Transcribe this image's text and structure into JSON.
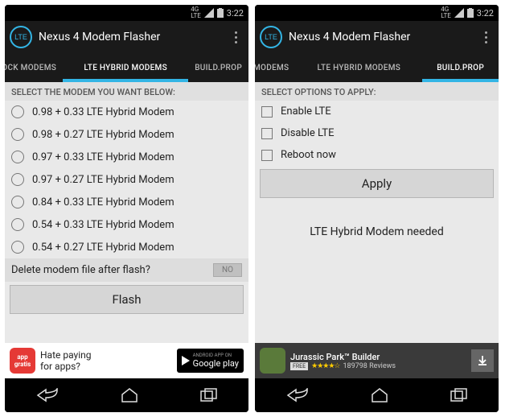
{
  "status": {
    "net": "4G\nLTE",
    "time": "3:22"
  },
  "app": {
    "title": "Nexus 4 Modem Flasher",
    "icon_label": "LTE"
  },
  "left": {
    "tabs": {
      "t0": "TOCK MODEMS",
      "t1": "LTE HYBRID MODEMS",
      "t2": "BUILD.PROP"
    },
    "section": "SELECT THE MODEM YOU WANT BELOW:",
    "modems": {
      "m0": "0.98 + 0.33 LTE Hybrid Modem",
      "m1": "0.98 + 0.27 LTE Hybrid Modem",
      "m2": "0.97 + 0.33 LTE Hybrid Modem",
      "m3": "0.97 + 0.27 LTE Hybrid Modem",
      "m4": "0.84 + 0.33 LTE Hybrid Modem",
      "m5": "0.54 + 0.33 LTE Hybrid Modem",
      "m6": "0.54 + 0.27 LTE Hybrid Modem"
    },
    "delete_q": "Delete modem file after flash?",
    "toggle": "NO",
    "flash": "Flash",
    "ad": {
      "icon": "app\ngratis",
      "line1": "Hate paying",
      "line2": "for apps?",
      "badge_top": "ANDROID APP ON",
      "badge": "Google play"
    }
  },
  "right": {
    "tabs": {
      "t0": "MODEMS",
      "t1": "LTE HYBRID MODEMS",
      "t2": "BUILD.PROP"
    },
    "section": "SELECT OPTIONS TO APPLY:",
    "opts": {
      "o0": "Enable LTE",
      "o1": "Disable LTE",
      "o2": "Reboot now"
    },
    "apply": "Apply",
    "msg": "LTE Hybrid Modem needed",
    "ad": {
      "title": "Jurassic Park™ Builder",
      "free": "FREE",
      "stars": "★★★★☆",
      "reviews": "189798 Reviews"
    }
  }
}
